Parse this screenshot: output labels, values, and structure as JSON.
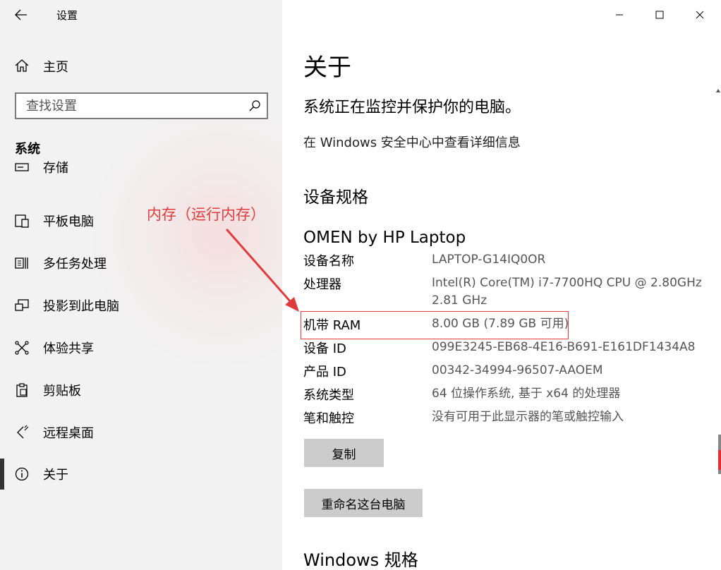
{
  "window": {
    "title": "设置"
  },
  "sidebar": {
    "home": "主页",
    "search_placeholder": "查找设置",
    "section": "系统",
    "items": [
      {
        "label": "存储",
        "icon": "storage-icon"
      },
      {
        "label": "平板电脑",
        "icon": "tablet-icon"
      },
      {
        "label": "多任务处理",
        "icon": "multitasking-icon"
      },
      {
        "label": "投影到此电脑",
        "icon": "project-icon"
      },
      {
        "label": "体验共享",
        "icon": "share-icon"
      },
      {
        "label": "剪贴板",
        "icon": "clipboard-icon"
      },
      {
        "label": "远程桌面",
        "icon": "remote-desktop-icon"
      },
      {
        "label": "关于",
        "icon": "info-icon",
        "active": true
      }
    ]
  },
  "content": {
    "title": "关于",
    "status": "系统正在监控并保护你的电脑。",
    "link": "在 Windows 安全中心中查看详细信息",
    "device_spec_title": "设备规格",
    "device_model": "OMEN by HP Laptop",
    "specs": [
      {
        "key": "设备名称",
        "value": "LAPTOP-G14IQ0OR"
      },
      {
        "key": "处理器",
        "value": "Intel(R) Core(TM) i7-7700HQ CPU @ 2.80GHz 2.81 GHz"
      },
      {
        "key": "机带 RAM",
        "value": "8.00 GB (7.89 GB 可用)"
      },
      {
        "key": "设备 ID",
        "value": "099E3245-EB68-4E16-B691-E161DF1434A8"
      },
      {
        "key": "产品 ID",
        "value": "00342-34994-96507-AAOEM"
      },
      {
        "key": "系统类型",
        "value": "64 位操作系统, 基于 x64 的处理器"
      },
      {
        "key": "笔和触控",
        "value": "没有可用于此显示器的笔或触控输入"
      }
    ],
    "copy_button": "复制",
    "rename_button": "重命名这台电脑",
    "windows_spec_title": "Windows 规格"
  },
  "annotation": {
    "label": "内存（运行内存）",
    "color": "#e23b3b"
  }
}
